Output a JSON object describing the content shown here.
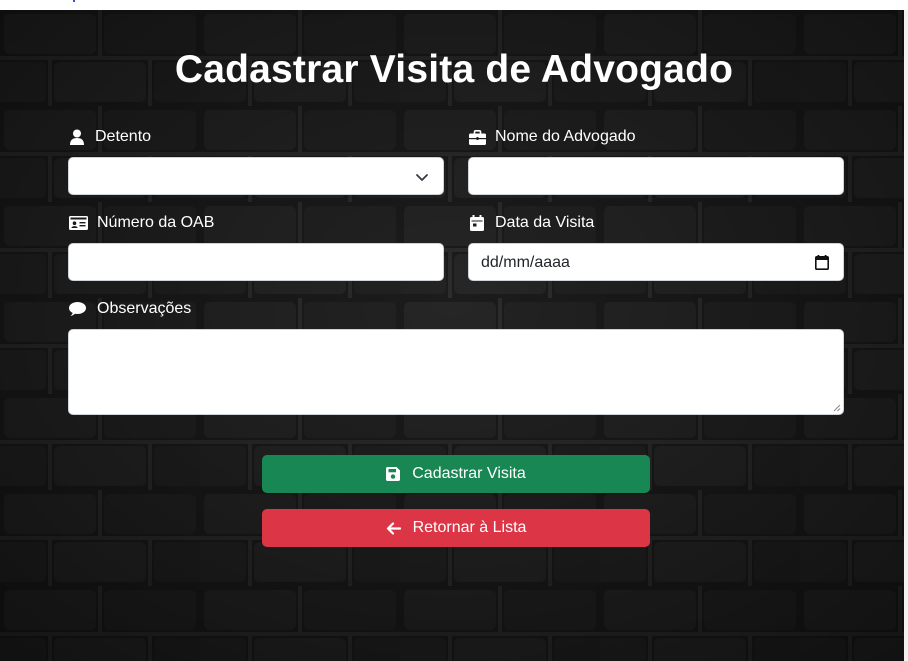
{
  "page": {
    "title": "Cadastrar Visita de Advogado"
  },
  "form": {
    "detento": {
      "label": "Detento",
      "icon": "user-icon",
      "value": ""
    },
    "nome_advogado": {
      "label": "Nome do Advogado",
      "icon": "briefcase-icon",
      "value": ""
    },
    "numero_oab": {
      "label": "Número da OAB",
      "icon": "id-card-icon",
      "value": ""
    },
    "data_visita": {
      "label": "Data da Visita",
      "icon": "calendar-icon",
      "placeholder": "dd/mm/aaaa"
    },
    "observacoes": {
      "label": "Observações",
      "icon": "comment-icon",
      "value": ""
    }
  },
  "actions": {
    "submit_label": "Cadastrar Visita",
    "submit_icon": "save-icon",
    "submit_color": "#198754",
    "back_label": "Retornar à Lista",
    "back_icon": "arrow-left-icon",
    "back_color": "#dc3545"
  }
}
